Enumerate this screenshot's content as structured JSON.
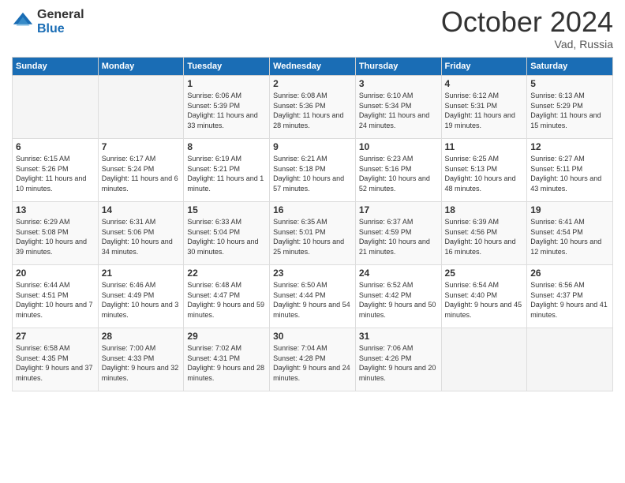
{
  "logo": {
    "general": "General",
    "blue": "Blue"
  },
  "header": {
    "month": "October 2024",
    "location": "Vad, Russia"
  },
  "days_of_week": [
    "Sunday",
    "Monday",
    "Tuesday",
    "Wednesday",
    "Thursday",
    "Friday",
    "Saturday"
  ],
  "weeks": [
    [
      {
        "day": "",
        "sunrise": "",
        "sunset": "",
        "daylight": ""
      },
      {
        "day": "",
        "sunrise": "",
        "sunset": "",
        "daylight": ""
      },
      {
        "day": "1",
        "sunrise": "Sunrise: 6:06 AM",
        "sunset": "Sunset: 5:39 PM",
        "daylight": "Daylight: 11 hours and 33 minutes."
      },
      {
        "day": "2",
        "sunrise": "Sunrise: 6:08 AM",
        "sunset": "Sunset: 5:36 PM",
        "daylight": "Daylight: 11 hours and 28 minutes."
      },
      {
        "day": "3",
        "sunrise": "Sunrise: 6:10 AM",
        "sunset": "Sunset: 5:34 PM",
        "daylight": "Daylight: 11 hours and 24 minutes."
      },
      {
        "day": "4",
        "sunrise": "Sunrise: 6:12 AM",
        "sunset": "Sunset: 5:31 PM",
        "daylight": "Daylight: 11 hours and 19 minutes."
      },
      {
        "day": "5",
        "sunrise": "Sunrise: 6:13 AM",
        "sunset": "Sunset: 5:29 PM",
        "daylight": "Daylight: 11 hours and 15 minutes."
      }
    ],
    [
      {
        "day": "6",
        "sunrise": "Sunrise: 6:15 AM",
        "sunset": "Sunset: 5:26 PM",
        "daylight": "Daylight: 11 hours and 10 minutes."
      },
      {
        "day": "7",
        "sunrise": "Sunrise: 6:17 AM",
        "sunset": "Sunset: 5:24 PM",
        "daylight": "Daylight: 11 hours and 6 minutes."
      },
      {
        "day": "8",
        "sunrise": "Sunrise: 6:19 AM",
        "sunset": "Sunset: 5:21 PM",
        "daylight": "Daylight: 11 hours and 1 minute."
      },
      {
        "day": "9",
        "sunrise": "Sunrise: 6:21 AM",
        "sunset": "Sunset: 5:18 PM",
        "daylight": "Daylight: 10 hours and 57 minutes."
      },
      {
        "day": "10",
        "sunrise": "Sunrise: 6:23 AM",
        "sunset": "Sunset: 5:16 PM",
        "daylight": "Daylight: 10 hours and 52 minutes."
      },
      {
        "day": "11",
        "sunrise": "Sunrise: 6:25 AM",
        "sunset": "Sunset: 5:13 PM",
        "daylight": "Daylight: 10 hours and 48 minutes."
      },
      {
        "day": "12",
        "sunrise": "Sunrise: 6:27 AM",
        "sunset": "Sunset: 5:11 PM",
        "daylight": "Daylight: 10 hours and 43 minutes."
      }
    ],
    [
      {
        "day": "13",
        "sunrise": "Sunrise: 6:29 AM",
        "sunset": "Sunset: 5:08 PM",
        "daylight": "Daylight: 10 hours and 39 minutes."
      },
      {
        "day": "14",
        "sunrise": "Sunrise: 6:31 AM",
        "sunset": "Sunset: 5:06 PM",
        "daylight": "Daylight: 10 hours and 34 minutes."
      },
      {
        "day": "15",
        "sunrise": "Sunrise: 6:33 AM",
        "sunset": "Sunset: 5:04 PM",
        "daylight": "Daylight: 10 hours and 30 minutes."
      },
      {
        "day": "16",
        "sunrise": "Sunrise: 6:35 AM",
        "sunset": "Sunset: 5:01 PM",
        "daylight": "Daylight: 10 hours and 25 minutes."
      },
      {
        "day": "17",
        "sunrise": "Sunrise: 6:37 AM",
        "sunset": "Sunset: 4:59 PM",
        "daylight": "Daylight: 10 hours and 21 minutes."
      },
      {
        "day": "18",
        "sunrise": "Sunrise: 6:39 AM",
        "sunset": "Sunset: 4:56 PM",
        "daylight": "Daylight: 10 hours and 16 minutes."
      },
      {
        "day": "19",
        "sunrise": "Sunrise: 6:41 AM",
        "sunset": "Sunset: 4:54 PM",
        "daylight": "Daylight: 10 hours and 12 minutes."
      }
    ],
    [
      {
        "day": "20",
        "sunrise": "Sunrise: 6:44 AM",
        "sunset": "Sunset: 4:51 PM",
        "daylight": "Daylight: 10 hours and 7 minutes."
      },
      {
        "day": "21",
        "sunrise": "Sunrise: 6:46 AM",
        "sunset": "Sunset: 4:49 PM",
        "daylight": "Daylight: 10 hours and 3 minutes."
      },
      {
        "day": "22",
        "sunrise": "Sunrise: 6:48 AM",
        "sunset": "Sunset: 4:47 PM",
        "daylight": "Daylight: 9 hours and 59 minutes."
      },
      {
        "day": "23",
        "sunrise": "Sunrise: 6:50 AM",
        "sunset": "Sunset: 4:44 PM",
        "daylight": "Daylight: 9 hours and 54 minutes."
      },
      {
        "day": "24",
        "sunrise": "Sunrise: 6:52 AM",
        "sunset": "Sunset: 4:42 PM",
        "daylight": "Daylight: 9 hours and 50 minutes."
      },
      {
        "day": "25",
        "sunrise": "Sunrise: 6:54 AM",
        "sunset": "Sunset: 4:40 PM",
        "daylight": "Daylight: 9 hours and 45 minutes."
      },
      {
        "day": "26",
        "sunrise": "Sunrise: 6:56 AM",
        "sunset": "Sunset: 4:37 PM",
        "daylight": "Daylight: 9 hours and 41 minutes."
      }
    ],
    [
      {
        "day": "27",
        "sunrise": "Sunrise: 6:58 AM",
        "sunset": "Sunset: 4:35 PM",
        "daylight": "Daylight: 9 hours and 37 minutes."
      },
      {
        "day": "28",
        "sunrise": "Sunrise: 7:00 AM",
        "sunset": "Sunset: 4:33 PM",
        "daylight": "Daylight: 9 hours and 32 minutes."
      },
      {
        "day": "29",
        "sunrise": "Sunrise: 7:02 AM",
        "sunset": "Sunset: 4:31 PM",
        "daylight": "Daylight: 9 hours and 28 minutes."
      },
      {
        "day": "30",
        "sunrise": "Sunrise: 7:04 AM",
        "sunset": "Sunset: 4:28 PM",
        "daylight": "Daylight: 9 hours and 24 minutes."
      },
      {
        "day": "31",
        "sunrise": "Sunrise: 7:06 AM",
        "sunset": "Sunset: 4:26 PM",
        "daylight": "Daylight: 9 hours and 20 minutes."
      },
      {
        "day": "",
        "sunrise": "",
        "sunset": "",
        "daylight": ""
      },
      {
        "day": "",
        "sunrise": "",
        "sunset": "",
        "daylight": ""
      }
    ]
  ]
}
